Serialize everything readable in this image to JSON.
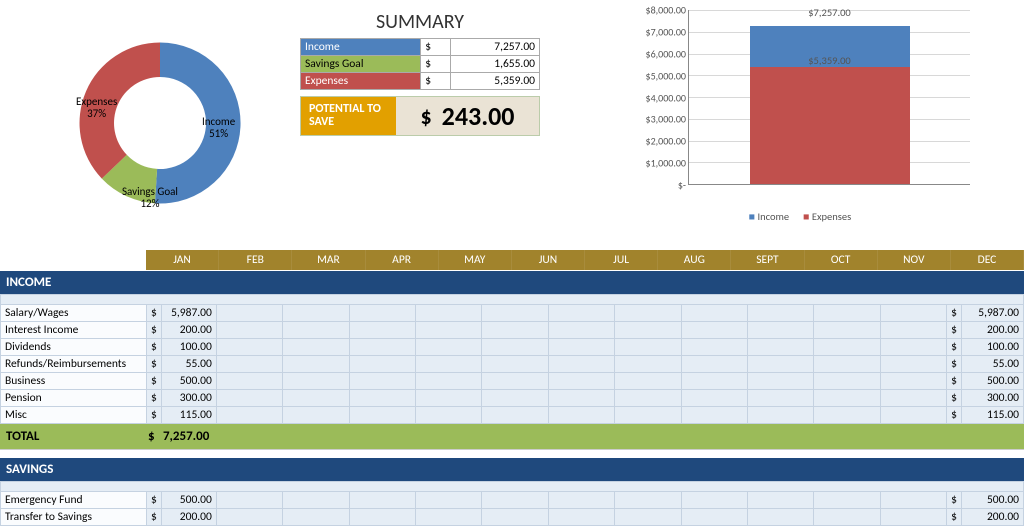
{
  "chart_data": [
    {
      "type": "pie",
      "title": "",
      "categories": [
        "Income",
        "Savings Goal",
        "Expenses"
      ],
      "values": [
        51,
        12,
        37
      ],
      "labels": [
        "Income 51%",
        "Savings Goal 12%",
        "Expenses 37%"
      ],
      "colors": [
        "#4e81bd",
        "#9bbb59",
        "#c0504d"
      ]
    },
    {
      "type": "bar",
      "stacked": true,
      "title": "",
      "xlabel": "",
      "ylabel": "",
      "ylim": [
        0,
        8000
      ],
      "ticks": [
        "$-",
        "$1,000.00",
        "$2,000.00",
        "$3,000.00",
        "$4,000.00",
        "$5,000.00",
        "$6,000.00",
        "$7,000.00",
        "$8,000.00"
      ],
      "categories": [
        ""
      ],
      "series": [
        {
          "name": "Income",
          "values": [
            7257
          ],
          "color": "#4e81bd",
          "data_label": "$7,257.00"
        },
        {
          "name": "Expenses",
          "values": [
            5359
          ],
          "color": "#c0504d",
          "data_label": "$5,359.00"
        }
      ]
    }
  ],
  "donut": {
    "income_label": "Income",
    "income_pct": "51%",
    "savings_label": "Savings Goal",
    "savings_pct": "12%",
    "expenses_label": "Expenses",
    "expenses_pct": "37%"
  },
  "summary": {
    "title": "SUMMARY",
    "rows": [
      {
        "label": "Income",
        "cur": "$",
        "val": "7,257.00"
      },
      {
        "label": "Savings Goal",
        "cur": "$",
        "val": "1,655.00"
      },
      {
        "label": "Expenses",
        "cur": "$",
        "val": "5,359.00"
      }
    ],
    "potential_label": "POTENTIAL TO SAVE",
    "potential_cur": "$",
    "potential_val": "243.00"
  },
  "barchart": {
    "top_label": "$7,257.00",
    "mid_label": "$5,359.00",
    "legend_income": "Income",
    "legend_expenses": "Expenses",
    "yticks": [
      "$8,000.00",
      "$7,000.00",
      "$6,000.00",
      "$5,000.00",
      "$4,000.00",
      "$3,000.00",
      "$2,000.00",
      "$1,000.00",
      "$-"
    ]
  },
  "months": [
    "JAN",
    "FEB",
    "MAR",
    "APR",
    "MAY",
    "JUN",
    "JUL",
    "AUG",
    "SEPT",
    "OCT",
    "NOV",
    "DEC"
  ],
  "income": {
    "title": "INCOME",
    "rows": [
      {
        "label": "Salary/Wages",
        "cur": "$",
        "val": "5,987.00",
        "tcur": "$",
        "tval": "5,987.00"
      },
      {
        "label": "Interest Income",
        "cur": "$",
        "val": "200.00",
        "tcur": "$",
        "tval": "200.00"
      },
      {
        "label": "Dividends",
        "cur": "$",
        "val": "100.00",
        "tcur": "$",
        "tval": "100.00"
      },
      {
        "label": "Refunds/Reimbursements",
        "cur": "$",
        "val": "55.00",
        "tcur": "$",
        "tval": "55.00"
      },
      {
        "label": "Business",
        "cur": "$",
        "val": "500.00",
        "tcur": "$",
        "tval": "500.00"
      },
      {
        "label": "Pension",
        "cur": "$",
        "val": "300.00",
        "tcur": "$",
        "tval": "300.00"
      },
      {
        "label": "Misc",
        "cur": "$",
        "val": "115.00",
        "tcur": "$",
        "tval": "115.00"
      }
    ],
    "total_label": "TOTAL",
    "total_cur": "$",
    "total_val": "7,257.00"
  },
  "savings": {
    "title": "SAVINGS",
    "rows": [
      {
        "label": "Emergency Fund",
        "cur": "$",
        "val": "500.00",
        "tcur": "$",
        "tval": "500.00"
      },
      {
        "label": "Transfer to Savings",
        "cur": "$",
        "val": "200.00",
        "tcur": "$",
        "tval": "200.00"
      }
    ]
  }
}
